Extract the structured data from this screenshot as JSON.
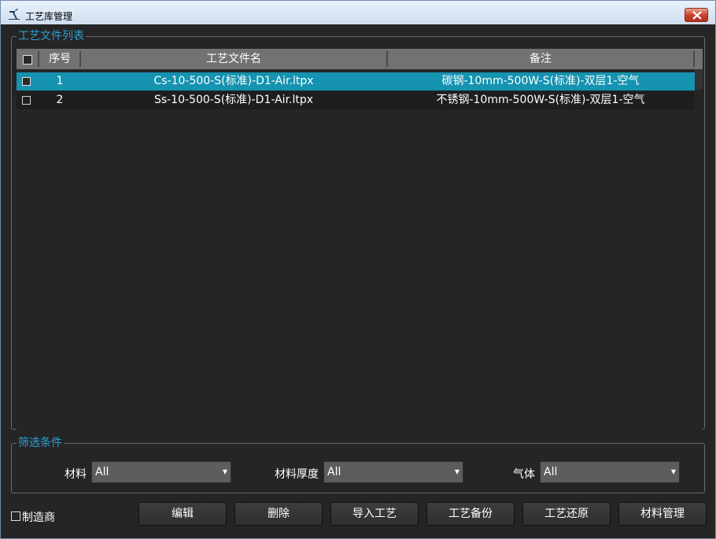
{
  "window": {
    "title": "工艺库管理"
  },
  "file_group": {
    "legend": "工艺文件列表",
    "columns": {
      "index": "序号",
      "filename": "工艺文件名",
      "remark": "备注"
    },
    "rows": [
      {
        "index": "1",
        "filename": "Cs-10-500-S(标准)-D1-Air.ltpx",
        "remark": "碳钢-10mm-500W-S(标准)-双层1-空气",
        "selected": true
      },
      {
        "index": "2",
        "filename": "Ss-10-500-S(标准)-D1-Air.ltpx",
        "remark": "不锈钢-10mm-500W-S(标准)-双层1-空气",
        "selected": false
      }
    ]
  },
  "filter_group": {
    "legend": "筛选条件",
    "material_label": "材料",
    "material_value": "All",
    "thickness_label": "材料厚度",
    "thickness_value": "All",
    "gas_label": "气体",
    "gas_value": "All"
  },
  "footer": {
    "manufacturer_label": "制造商",
    "buttons": {
      "edit": "编辑",
      "delete": "删除",
      "import": "导入工艺",
      "backup": "工艺备份",
      "restore": "工艺还原",
      "material": "材料管理"
    }
  },
  "colors": {
    "accent": "#2d9fd3",
    "selected_row": "#1593b0",
    "header": "#727272",
    "background": "#252525"
  },
  "icons": {
    "app": "welding-torch-icon",
    "close": "close-icon",
    "dropdown": "dropdown-arrow-icon"
  }
}
